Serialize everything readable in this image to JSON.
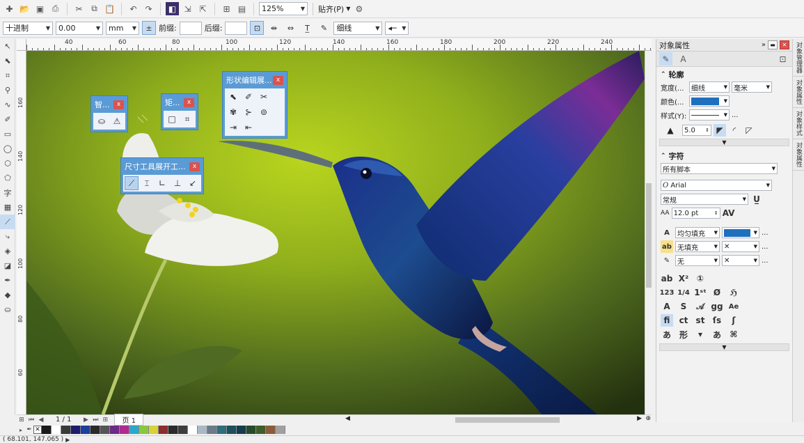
{
  "toolbar": {
    "zoom": "125%",
    "snap_label": "贴齐(P)"
  },
  "property_bar": {
    "units_mode": "十进制",
    "precision": "0.00",
    "units": "mm",
    "prefix_label": "前缀:",
    "suffix_label": "后缀:",
    "line_style": "细线"
  },
  "ruler": {
    "h_labels": [
      "40",
      "60",
      "80",
      "100",
      "120",
      "140",
      "160",
      "180",
      "200",
      "220",
      "240"
    ],
    "v_labels": [
      "160",
      "140",
      "120",
      "100",
      "80",
      "60"
    ]
  },
  "floaters": {
    "smart": {
      "title": "智..."
    },
    "rect": {
      "title": "矩..."
    },
    "shape": {
      "title": "形状编辑展..."
    },
    "dimension": {
      "title": "尺寸工具展开工..."
    },
    "close": "x"
  },
  "pagebar": {
    "page_counter": "1 / 1",
    "page_tab": "页 1"
  },
  "palette": {
    "colors": [
      "#1a1a1a",
      "#ffffff",
      "#3a3a3a",
      "#1d1d6b",
      "#1c3f9b",
      "#2a2a2a",
      "#555555",
      "#6d2a86",
      "#b02a8f",
      "#2aa8c7",
      "#8ac63f",
      "#d7d23a",
      "#8b2e2e",
      "#2b2b2b",
      "#3d3d3d",
      "#ffffff",
      "#aab8c4",
      "#6b7b8a",
      "#2f6e7c",
      "#1e4f5e",
      "#183b4d",
      "#274a2a",
      "#3f5d2b",
      "#8a5b3a",
      "#a0a0a0"
    ]
  },
  "status": {
    "coords": "( 68.101, 147.065 )"
  },
  "panel": {
    "title": "对象属性",
    "outline_label": "轮廓",
    "width_label": "宽度(...",
    "width_value": "细线",
    "width_unit": "毫米",
    "color_label": "颜色(...",
    "outline_color": "#1f6fbf",
    "style_label": "样式(Y):",
    "miter_value": "5.0",
    "char_label": "字符",
    "script_value": "所有脚本",
    "font_value": "Arial",
    "style_value": "常规",
    "size_value": "12.0 pt",
    "fill1_label": "均匀填充",
    "fill1_color": "#1f6fbf",
    "fill2_label": "无填充",
    "fill3_label": "无",
    "ellipsis": "..."
  },
  "docker_tabs": [
    "对象管理器",
    "对象属性",
    "对象样式",
    "对象属性"
  ]
}
